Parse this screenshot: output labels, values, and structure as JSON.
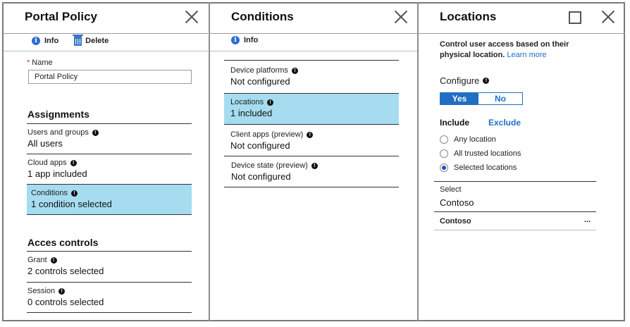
{
  "policy": {
    "title": "Portal Policy",
    "toolbar": {
      "info": "Info",
      "delete": "Delete"
    },
    "name_label": "Name",
    "name_value": "Portal Policy",
    "assignments_heading": "Assignments",
    "assignments": [
      {
        "label": "Users and groups",
        "value": "All users"
      },
      {
        "label": "Cloud apps",
        "value": "1 app included"
      },
      {
        "label": "Conditions",
        "value": "1 condition selected"
      }
    ],
    "access_heading": "Acces controls",
    "access": [
      {
        "label": "Grant",
        "value": "2 controls selected"
      },
      {
        "label": "Session",
        "value": "0 controls selected"
      }
    ]
  },
  "conditions": {
    "title": "Conditions",
    "toolbar": {
      "info": "Info"
    },
    "items": [
      {
        "label": "Device platforms",
        "value": "Not configured"
      },
      {
        "label": "Locations",
        "value": "1 included"
      },
      {
        "label": "Client apps (preview)",
        "value": "Not configured"
      },
      {
        "label": "Device state (preview)",
        "value": "Not configured"
      }
    ]
  },
  "locations": {
    "title": "Locations",
    "description": "Control user access based on their physical location.",
    "learn_more": "Learn more",
    "configure_label": "Configure",
    "toggle": {
      "yes": "Yes",
      "no": "No",
      "selected": "Yes"
    },
    "tabs": {
      "include": "Include",
      "exclude": "Exclude"
    },
    "radios": [
      {
        "label": "Any location",
        "checked": false
      },
      {
        "label": "All trusted locations",
        "checked": false
      },
      {
        "label": "Selected locations",
        "checked": true
      }
    ],
    "select_label": "Select",
    "select_value": "Contoso",
    "selected_item": "Contoso",
    "more": "..."
  },
  "colors": {
    "highlight": "#a6dcef",
    "accent": "#1f6fc2",
    "required": "#d13438"
  }
}
